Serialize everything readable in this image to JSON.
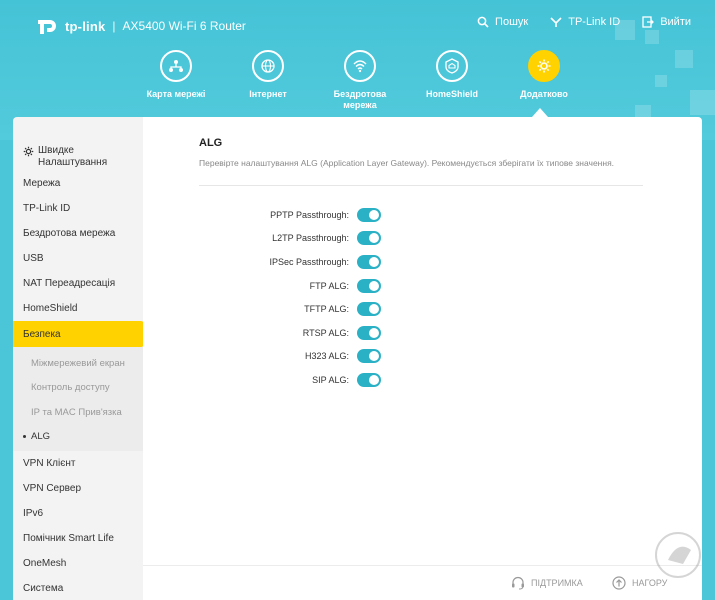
{
  "brand": {
    "logo": "tp-link",
    "model": "AX5400 Wi-Fi 6 Router"
  },
  "top_actions": [
    {
      "label": "Пошук",
      "icon": "search-icon"
    },
    {
      "label": "TP-Link ID",
      "icon": "tplink-id-icon"
    },
    {
      "label": "Вийти",
      "icon": "logout-icon"
    }
  ],
  "nav": [
    {
      "label": "Карта мережі",
      "icon": "network-map-icon"
    },
    {
      "label": "Інтернет",
      "icon": "globe-icon"
    },
    {
      "label": "Бездротова мережа",
      "icon": "wifi-icon"
    },
    {
      "label": "HomeShield",
      "icon": "home-shield-icon"
    },
    {
      "label": "Додатково",
      "icon": "gear-icon",
      "active": true
    }
  ],
  "sidebar": {
    "quick_setup": "Швидке Налаштування",
    "items_before": [
      "Мережа",
      "TP-Link ID",
      "Бездротова мережа",
      "USB",
      "NAT Переадресація",
      "HomeShield"
    ],
    "active_item": "Безпека",
    "sub_items": [
      "Міжмережевий екран",
      "Контроль доступу",
      "IP та MAC Прив'язка",
      "ALG"
    ],
    "current_sub": "ALG",
    "items_after": [
      "VPN Клієнт",
      "VPN Сервер",
      "IPv6",
      "Помічник Smart Life",
      "OneMesh",
      "Система"
    ]
  },
  "main": {
    "title": "ALG",
    "description": "Перевірте налаштування ALG (Application Layer Gateway). Рекомендується зберігати їх типове значення.",
    "rows": [
      {
        "label": "PPTP Passthrough:",
        "enabled": true
      },
      {
        "label": "L2TP Passthrough:",
        "enabled": true
      },
      {
        "label": "IPSec Passthrough:",
        "enabled": true
      },
      {
        "label": "FTP ALG:",
        "enabled": true
      },
      {
        "label": "TFTP ALG:",
        "enabled": true
      },
      {
        "label": "RTSP ALG:",
        "enabled": true
      },
      {
        "label": "H323 ALG:",
        "enabled": true
      },
      {
        "label": "SIP ALG:",
        "enabled": true
      }
    ]
  },
  "footer": {
    "support": "ПІДТРИМКА",
    "back_to_top": "НАГОРУ"
  },
  "colors": {
    "header": "#4ac6d8",
    "accent": "#ffd200",
    "toggle": "#2ab1c6"
  }
}
